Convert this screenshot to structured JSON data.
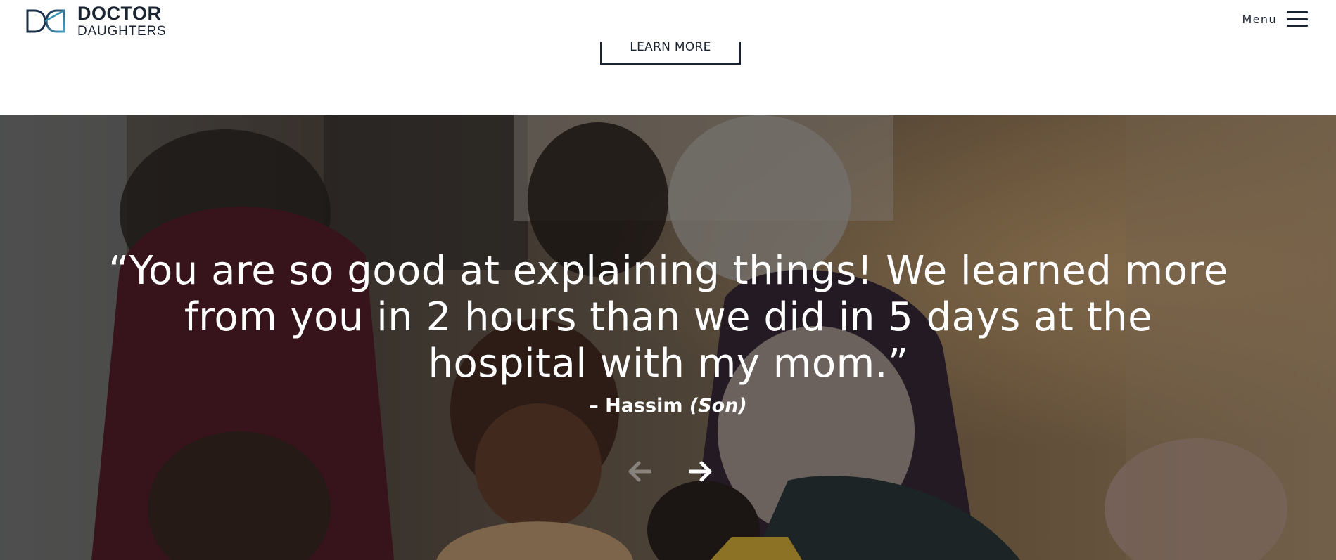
{
  "header": {
    "logo": {
      "line1": "DOCTOR",
      "line2": "DAUGHTERS",
      "icon": "dd-logo-icon"
    },
    "menu": {
      "label": "Menu",
      "icon": "hamburger-icon"
    }
  },
  "cta": {
    "learn_more_label": "LEARN MORE"
  },
  "testimonial": {
    "quote": "“You are so good at explaining things! We learned more from you in 2 hours than we did in 5 days at the hospital with my mom.”",
    "dash": "– ",
    "author": "Hassim",
    "relation": "(Son)",
    "prev_icon": "arrow-left-icon",
    "next_icon": "arrow-right-icon"
  },
  "colors": {
    "brand_dark": "#1a2330",
    "brand_teal": "#3a8fb0",
    "text_on_image": "#ffffff"
  }
}
